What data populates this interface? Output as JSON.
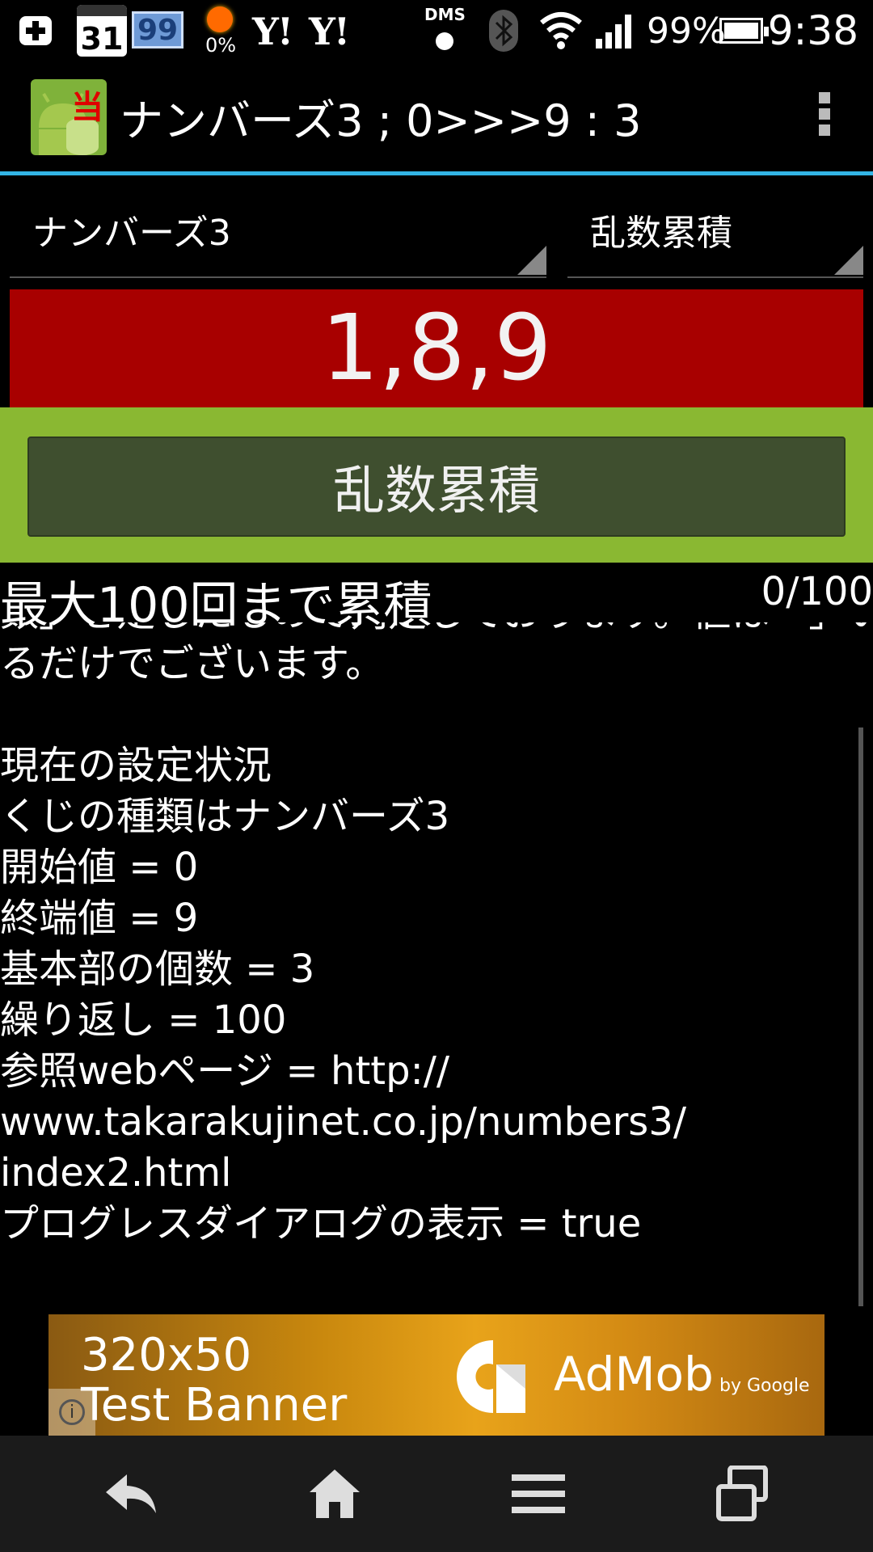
{
  "status_bar": {
    "calendar_day": "31",
    "battery_widget_value": "99",
    "weather_percent": "0%",
    "yahoo_1": "Y!",
    "yahoo_2": "Y!",
    "dms_label": "DMS",
    "battery_percent": "99%",
    "time": "9:38",
    "icons": [
      "plus-icon",
      "calendar-icon",
      "battery-widget-icon",
      "weather-icon",
      "yahoo-icon",
      "dms-icon",
      "bluetooth-icon",
      "wifi-icon",
      "signal-icon",
      "battery-icon"
    ]
  },
  "action_bar": {
    "app_icon_kanji": "当",
    "title": "ナンバーズ3 ; 0>>>9 : 3",
    "overflow_icon": "overflow-menu-icon"
  },
  "spinners": {
    "lottery_type": "ナンバーズ3",
    "mode": "乱数累積"
  },
  "result": {
    "value": "1,8,9",
    "color": "#a80000"
  },
  "main_button": {
    "label": "乱数累積",
    "area_color": "#8ab832"
  },
  "info": {
    "title": "最大100回まで累積",
    "counter": "0/100",
    "cut_line": "数」を足したもので判定しております。値は「」いさせて",
    "partial_line": "るだけでございます。",
    "lines": [
      "",
      "現在の設定状況",
      "くじの種類はナンバーズ3",
      "開始値 = 0",
      "終端値 = 9",
      "基本部の個数 = 3",
      "繰り返し = 100",
      "参照webページ = http://",
      "www.takarakujinet.co.jp/numbers3/",
      "index2.html",
      "プログレスダイアログの表示 = true"
    ]
  },
  "ad": {
    "size_text": "320x50",
    "banner_text": "Test Banner",
    "brand": "AdMob",
    "by": "by Google"
  },
  "nav": {
    "icons": [
      "back-icon",
      "home-icon",
      "menu-icon",
      "recent-apps-icon"
    ]
  }
}
